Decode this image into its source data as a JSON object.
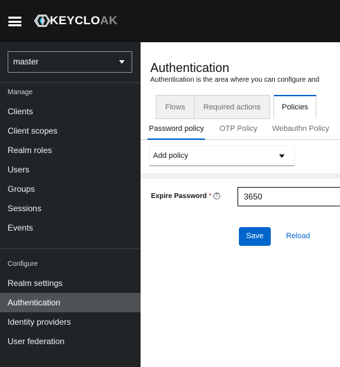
{
  "masthead": {
    "menu_icon": "hamburger-icon",
    "logo_icon": "keycloak-logo-icon",
    "brand_main": "KEYCLO",
    "brand_tail": "AK"
  },
  "sidebar": {
    "realm": {
      "selected": "master",
      "icon": "caret-down-icon"
    },
    "sections": [
      {
        "title": "Manage",
        "items": [
          {
            "label": "Clients"
          },
          {
            "label": "Client scopes"
          },
          {
            "label": "Realm roles"
          },
          {
            "label": "Users"
          },
          {
            "label": "Groups"
          },
          {
            "label": "Sessions"
          },
          {
            "label": "Events"
          }
        ]
      },
      {
        "title": "Configure",
        "items": [
          {
            "label": "Realm settings"
          },
          {
            "label": "Authentication",
            "active": true
          },
          {
            "label": "Identity providers"
          },
          {
            "label": "User federation"
          }
        ]
      }
    ]
  },
  "main": {
    "title": "Authentication",
    "description": "Authentication is the area where you can configure and",
    "tabs": [
      {
        "label": "Flows"
      },
      {
        "label": "Required actions"
      },
      {
        "label": "Policies",
        "active": true
      }
    ],
    "subtabs": [
      {
        "label": "Password policy",
        "active": true
      },
      {
        "label": "OTP Policy"
      },
      {
        "label": "Webauthn Policy"
      }
    ],
    "add_policy": {
      "label": "Add policy",
      "icon": "caret-down-icon"
    },
    "form": {
      "expire_password": {
        "label": "Expire Password",
        "required_mark": "*",
        "help_icon": "help-icon",
        "help_glyph": "?",
        "value": "3650"
      },
      "save_label": "Save",
      "reload_label": "Reload"
    }
  },
  "colors": {
    "masthead_bg": "#151515",
    "sidebar_bg": "#212427",
    "sidebar_active_bg": "#4f5255",
    "primary": "#0066cc",
    "required": "#c9190b"
  }
}
